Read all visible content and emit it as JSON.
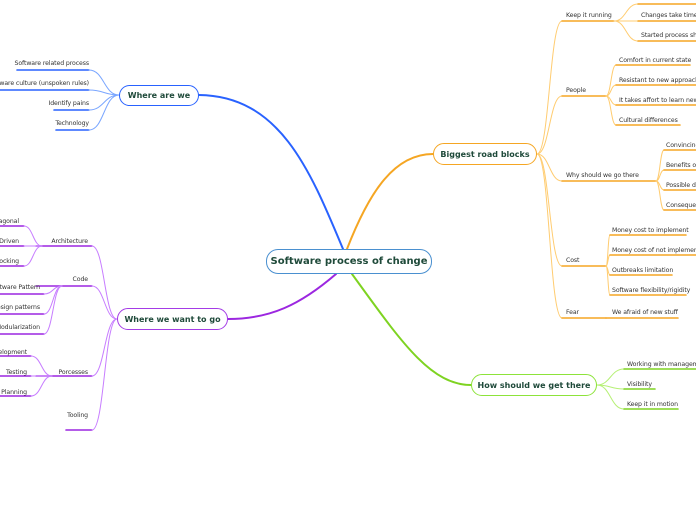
{
  "root": {
    "label": "Software process of change",
    "color": "#4a90d0"
  },
  "branches": {
    "where_are_we": {
      "label": "Where are we",
      "color": "#2962ff",
      "children": [
        "Software related process",
        "Software culture (unspoken rules)",
        "Identify pains",
        "Technology"
      ]
    },
    "where_we_want_to_go": {
      "label": "Where we want to go",
      "color": "#9c27e0",
      "children": [
        {
          "label": "Architecture",
          "children": [
            "Hexagonal",
            "Domain Driven",
            "Non-blocking"
          ]
        },
        {
          "label": "Code",
          "children": [
            "Software Pattern",
            "Design patterns",
            "Modularization"
          ]
        },
        {
          "label": "Porcesses",
          "children": [
            "Development",
            "Testing",
            "Planning"
          ]
        },
        {
          "label": "Tooling",
          "children": []
        }
      ]
    },
    "biggest_road_blocks": {
      "label": "Biggest road blocks",
      "color": "#f5a623",
      "children": [
        {
          "label": "Keep it running",
          "children": [
            "",
            "Changes take time",
            "Started process should"
          ]
        },
        {
          "label": "People",
          "children": [
            "Comfort in current state",
            "Resistant to new approach",
            "It takes affort to learn new ways",
            "Cultural differences"
          ]
        },
        {
          "label": "Why should we go there",
          "children": [
            "Convincing",
            "Benefits of",
            "Possible dr",
            "Consequen"
          ]
        },
        {
          "label": "Cost",
          "children": [
            "Money cost to implement",
            "Money cost of not implementing",
            "Outbreaks limitation",
            "Software flexibility/rigidity"
          ]
        },
        {
          "label": "Fear",
          "children": [
            "We afraid of new stuff"
          ]
        }
      ]
    },
    "how_should_we_get_there": {
      "label": "How should we get there",
      "color": "#7ed321",
      "children": [
        "Working with management",
        "Visibility",
        "Keep it in motion"
      ]
    }
  }
}
